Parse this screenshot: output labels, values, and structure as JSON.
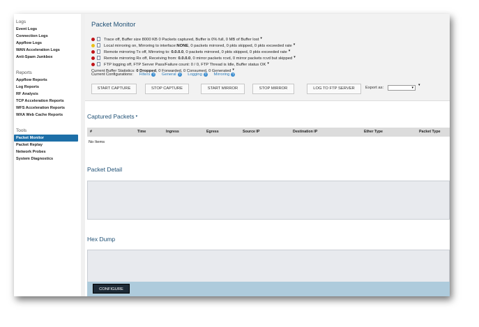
{
  "sidebar": {
    "groups": [
      {
        "heading": "Logs",
        "items": [
          "Event Logs",
          "Connection Logs",
          "Appflow Logs",
          "WAN Acceleration Logs",
          "Anti-Spam Junkbox"
        ]
      },
      {
        "heading": "Reports",
        "items": [
          "Appflow Reports",
          "Log Reports",
          "RF Analysis",
          "TCP Acceleration Reports",
          "WFS Acceleration Reports",
          "WXA Web Cache Reports"
        ]
      },
      {
        "heading": "Tools",
        "items": [
          "Packet Monitor",
          "Packet Replay",
          "Network Probes",
          "System Diagnostics"
        ],
        "active": "Packet Monitor"
      }
    ]
  },
  "packet_monitor": {
    "title": "Packet Monitor",
    "status": [
      {
        "color": "red",
        "text": "Trace off,   Buffer size 8000 KB  0 Packets captured,   Buffer is 0% full,    0 MB of Buffer lost"
      },
      {
        "color": "yellow",
        "text_a": "Local mirroring on,    Mirroring to interface:",
        "bold": "NONE",
        "text_b": ",   0 packets mirrored,    0 pkts skipped,   0 pkts exceeded rate"
      },
      {
        "color": "red",
        "text_a": "Remote mirroring Tx off,    Mirroring to: ",
        "bold": "0.0.0.0",
        "text_b": ",    0 packets mirrored,    0 pkts skipped,    0 pkts exceeded rate"
      },
      {
        "color": "red",
        "text_a": "Remote mirroring Rx off,    Receiving from: ",
        "bold": "0.0.0.0",
        "text_b": ",   0 mirror packets rcvd,    0 mirror packets rcvd but skipped"
      },
      {
        "color": "red",
        "text": "FTP logging off,   FTP Server Pass/Failure count: 0 / 0,    FTP Thread is Idle,   Buffer status OK"
      }
    ],
    "buffer_stats": {
      "label": "Current Buffer Statistics:",
      "dropped": "0 Dropped",
      "rest": ", 0 Forwarded, 0 Consumed, 0 Generated"
    },
    "configurations": {
      "label": "Current Configurations:",
      "links": [
        "Filters",
        "General",
        "Logging",
        "Mirroring"
      ]
    },
    "buttons": [
      "START CAPTURE",
      "STOP CAPTURE",
      "START MIRROR",
      "STOP MIRROR",
      "LOG TO FTP SERVER"
    ],
    "export_label": "Export as:",
    "export_value": ""
  },
  "captured": {
    "title": "Captured Packets",
    "columns": [
      "#",
      "Time",
      "Ingress",
      "Egress",
      "Source IP",
      "Destination IP",
      "Ether Type",
      "Packet Type"
    ],
    "empty_text": "No Items"
  },
  "detail": {
    "title": "Packet Detail"
  },
  "hex": {
    "title": "Hex Dump"
  },
  "footer": {
    "configure": "CONFIGURE"
  },
  "colors": {
    "accent": "#1d6fa8",
    "title": "#1e4f74",
    "link": "#2a7ab8",
    "status_red": "#c0141a",
    "status_yellow": "#e9c01a"
  }
}
